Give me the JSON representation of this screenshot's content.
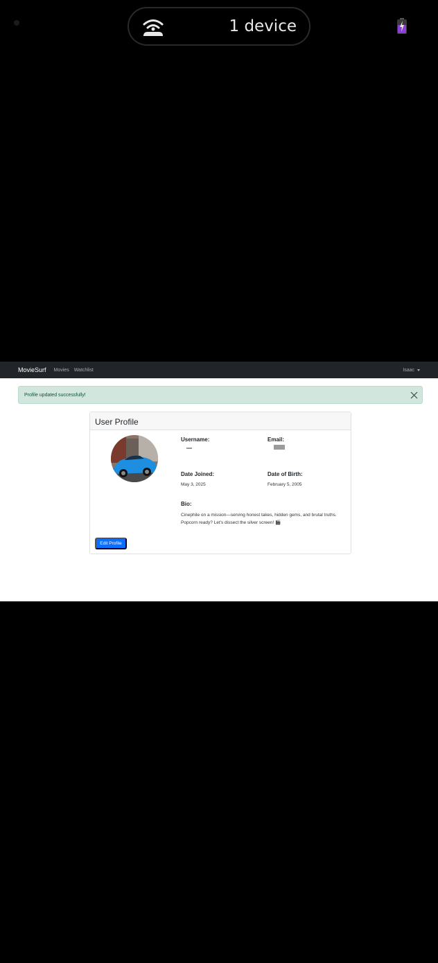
{
  "status_bar": {
    "connection_text": "1 device",
    "battery_color": "#8b3fd6"
  },
  "navbar": {
    "brand": "MovieSurf",
    "links": [
      "Movies",
      "Watchlist"
    ],
    "user": "Isaac"
  },
  "alert": {
    "message": "Profile updated successfully!"
  },
  "profile": {
    "title": "User Profile",
    "username_label": "Username:",
    "username_value": "",
    "email_label": "Email:",
    "email_value": "",
    "joined_label": "Date Joined:",
    "joined_value": "May 3, 2025",
    "dob_label": "Date of Birth:",
    "dob_value": "February 5, 2005",
    "bio_label": "Bio:",
    "bio_value": "Cinephile on a mission—serving honest takes, hidden gems, and brutal truths. Popcorn ready? Let's dissect the silver screen! 🎬",
    "edit_button": "Edit Profile"
  },
  "colors": {
    "primary": "#0d6efd",
    "alert_bg": "#d1e7dd",
    "navbar_bg": "#212529"
  }
}
